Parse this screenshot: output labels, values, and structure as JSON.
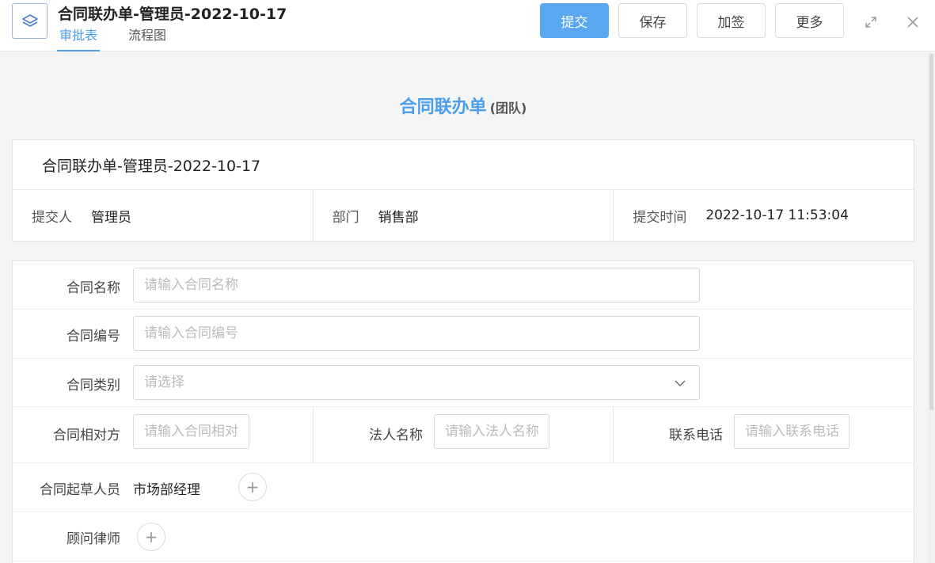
{
  "header": {
    "title": "合同联办单-管理员-2022-10-17",
    "tabs": [
      {
        "label": "审批表",
        "active": true
      },
      {
        "label": "流程图",
        "active": false
      }
    ],
    "buttons": {
      "submit": "提交",
      "save": "保存",
      "sign": "加签",
      "more": "更多"
    },
    "icons": [
      "layers-icon",
      "expand-icon",
      "close-icon"
    ]
  },
  "form_heading": {
    "title": "合同联办单",
    "subtitle": "(团队)"
  },
  "info": {
    "title": "合同联办单-管理员-2022-10-17",
    "submitter_label": "提交人",
    "submitter": "管理员",
    "dept_label": "部门",
    "dept": "销售部",
    "time_label": "提交时间",
    "time": "2022-10-17 11:53:04"
  },
  "fields": {
    "contract_name": {
      "label": "合同名称",
      "placeholder": "请输入合同名称"
    },
    "contract_no": {
      "label": "合同编号",
      "placeholder": "请输入合同编号"
    },
    "contract_type": {
      "label": "合同类别",
      "placeholder": "请选择"
    },
    "counterparty": {
      "label": "合同相对方",
      "placeholder": "请输入合同相对"
    },
    "legal_name": {
      "label": "法人名称",
      "placeholder": "请输入法人名称"
    },
    "phone": {
      "label": "联系电话",
      "placeholder": "请输入联系电话"
    },
    "drafter": {
      "label": "合同起草人员",
      "value": "市场部经理"
    },
    "lawyer": {
      "label": "顾问律师"
    }
  },
  "colors": {
    "accent": "#4a9eea",
    "submit_button": "#58a7ef"
  }
}
